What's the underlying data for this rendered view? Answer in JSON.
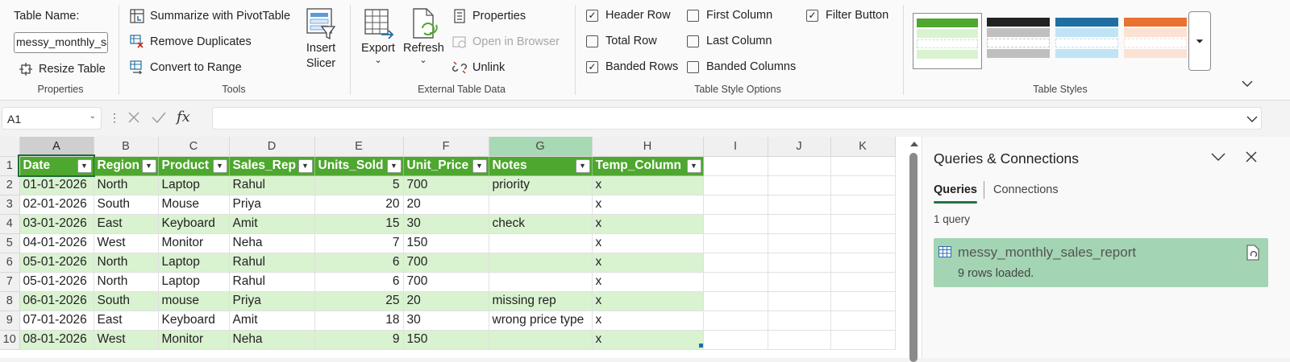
{
  "ribbon": {
    "properties": {
      "table_name_label": "Table Name:",
      "table_name_value": "messy_monthly_sales_report",
      "resize_label": "Resize Table",
      "group_label": "Properties"
    },
    "tools": {
      "pivot_label": "Summarize with PivotTable",
      "dupes_label": "Remove Duplicates",
      "convert_label": "Convert to Range",
      "slicer_line1": "Insert",
      "slicer_line2": "Slicer",
      "group_label": "Tools"
    },
    "external": {
      "export_label": "Export",
      "refresh_label": "Refresh",
      "properties_label": "Properties",
      "open_browser_label": "Open in Browser",
      "unlink_label": "Unlink",
      "group_label": "External Table Data"
    },
    "style_options": {
      "header_row": "Header Row",
      "total_row": "Total Row",
      "banded_rows": "Banded Rows",
      "first_column": "First Column",
      "last_column": "Last Column",
      "banded_columns": "Banded Columns",
      "filter_button": "Filter Button",
      "group_label": "Table Style Options"
    },
    "styles": {
      "group_label": "Table Styles",
      "swatch_colors": [
        "#4ea72e",
        "#222222",
        "#1f6fa3",
        "#e97132"
      ],
      "swatch_band_colors": [
        "#d9f2d0",
        "#bfbfbf",
        "#c0e4f5",
        "#fbe2d5"
      ]
    }
  },
  "formula_bar": {
    "cell_ref": "A1",
    "fx": "fx"
  },
  "grid": {
    "col_letters": [
      "A",
      "B",
      "C",
      "D",
      "E",
      "F",
      "G",
      "H",
      "I",
      "J",
      "K"
    ],
    "headers": [
      "Date",
      "Region",
      "Product",
      "Sales_Rep",
      "Units_Sold",
      "Unit_Price",
      "Notes",
      "Temp_Column"
    ],
    "rows": [
      [
        "01-01-2026",
        "North",
        "Laptop",
        "Rahul",
        "5",
        "700",
        "priority",
        "x"
      ],
      [
        "02-01-2026",
        "South",
        "Mouse",
        "Priya",
        "20",
        "20",
        "",
        "x"
      ],
      [
        "03-01-2026",
        "East",
        "Keyboard",
        "Amit",
        "15",
        "30",
        "check",
        "x"
      ],
      [
        "04-01-2026",
        "West",
        "Monitor",
        "Neha",
        "7",
        "150",
        "",
        "x"
      ],
      [
        "05-01-2026",
        "North",
        "Laptop",
        "Rahul",
        "6",
        "700",
        "",
        "x"
      ],
      [
        "05-01-2026",
        "North",
        "Laptop",
        "Rahul",
        "6",
        "700",
        "",
        "x"
      ],
      [
        "06-01-2026",
        "South",
        "mouse",
        "Priya",
        "25",
        "20",
        "missing rep",
        "x"
      ],
      [
        "07-01-2026",
        "East",
        "Keyboard",
        "Amit",
        "18",
        "30",
        "wrong price type",
        "x"
      ],
      [
        "08-01-2026",
        "West",
        "Monitor",
        "Neha",
        "9",
        "150",
        "",
        "x"
      ]
    ]
  },
  "queries_pane": {
    "title": "Queries & Connections",
    "tab_queries": "Queries",
    "tab_connections": "Connections",
    "count": "1 query",
    "query_name": "messy_monthly_sales_report",
    "query_status": "9 rows loaded."
  }
}
